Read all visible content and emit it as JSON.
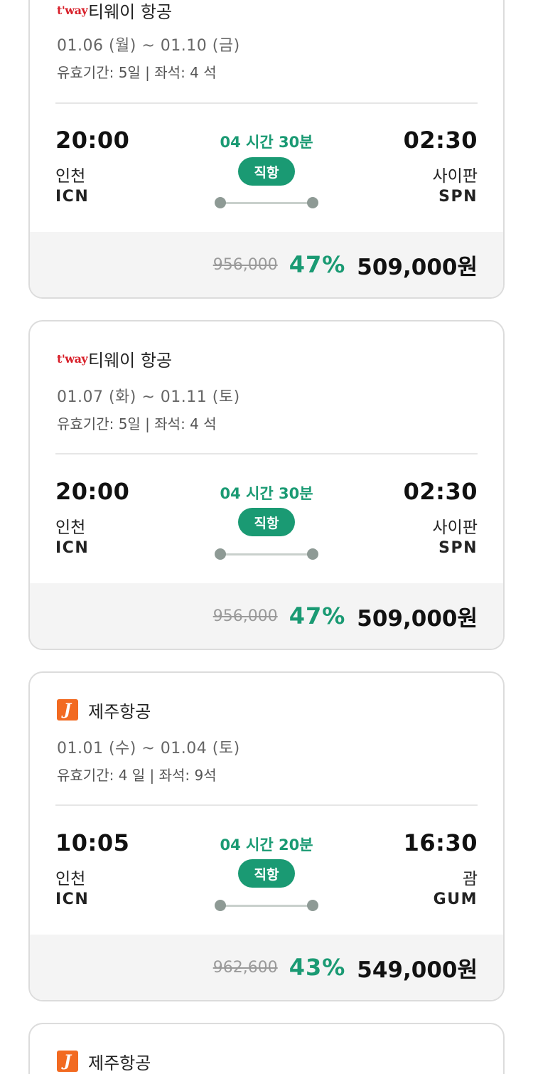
{
  "flights": [
    {
      "logo": "tway-logo",
      "logo_text": "t'way",
      "airline": "티웨이 항공",
      "dates": "01.06 (월) ~ 01.10 (금)",
      "meta": "유효기간: 5일 | 좌석: 4 석",
      "dep_time": "20:00",
      "dep_city": "인천",
      "dep_code": "ICN",
      "duration": "04 시간 30분",
      "badge": "직항",
      "arr_time": "02:30",
      "arr_city": "사이판",
      "arr_code": "SPN",
      "orig_price": "956,000",
      "discount": "47%",
      "price": "509,000원"
    },
    {
      "logo": "tway-logo",
      "logo_text": "t'way",
      "airline": "티웨이 항공",
      "dates": "01.07 (화) ~ 01.11 (토)",
      "meta": "유효기간: 5일 | 좌석: 4 석",
      "dep_time": "20:00",
      "dep_city": "인천",
      "dep_code": "ICN",
      "duration": "04 시간 30분",
      "badge": "직항",
      "arr_time": "02:30",
      "arr_city": "사이판",
      "arr_code": "SPN",
      "orig_price": "956,000",
      "discount": "47%",
      "price": "509,000원"
    },
    {
      "logo": "jeju-air-logo",
      "logo_text": "J",
      "airline": "제주항공",
      "dates": "01.01 (수) ~ 01.04 (토)",
      "meta": "유효기간: 4 일 | 좌석: 9석",
      "dep_time": "10:05",
      "dep_city": "인천",
      "dep_code": "ICN",
      "duration": "04 시간 20분",
      "badge": "직항",
      "arr_time": "16:30",
      "arr_city": "괌",
      "arr_code": "GUM",
      "orig_price": "962,600",
      "discount": "43%",
      "price": "549,000원"
    },
    {
      "logo": "jeju-air-logo",
      "logo_text": "J",
      "airline": "제주항공"
    }
  ],
  "colors": {
    "accent": "#1a9a73",
    "tway_red": "#d8202a",
    "jeju_orange": "#f26a21"
  }
}
